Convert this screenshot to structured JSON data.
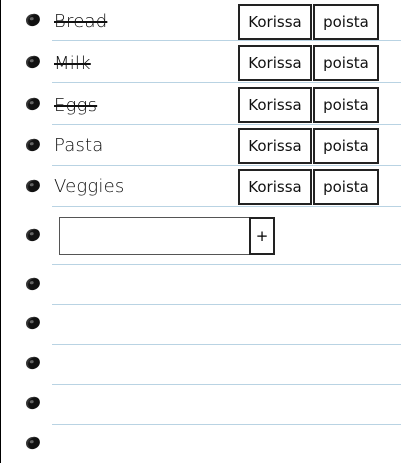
{
  "items": [
    {
      "text": "Bread",
      "done": true,
      "basket_label": "Korissa",
      "remove_label": "poista"
    },
    {
      "text": "Milk",
      "done": true,
      "basket_label": "Korissa",
      "remove_label": "poista"
    },
    {
      "text": "Eggs",
      "done": true,
      "basket_label": "Korissa",
      "remove_label": "poista"
    },
    {
      "text": "Pasta",
      "done": false,
      "basket_label": "Korissa",
      "remove_label": "poista"
    },
    {
      "text": "Veggies",
      "done": false,
      "basket_label": "Korissa",
      "remove_label": "poista"
    }
  ],
  "new_item": {
    "value": "",
    "add_label": "+"
  },
  "colors": {
    "rule": "#b9d3e3",
    "ink": "#111111"
  }
}
